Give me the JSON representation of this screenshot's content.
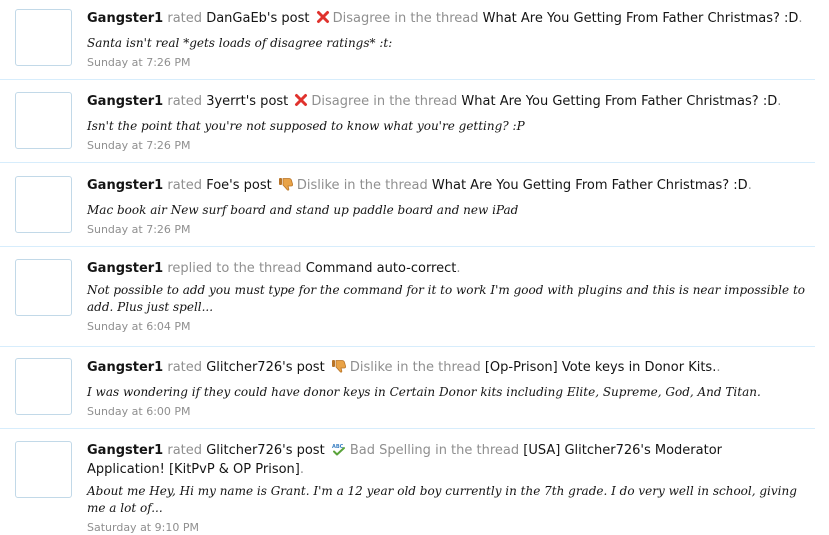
{
  "items": [
    {
      "user": "Gangster1",
      "verb": "rated",
      "target": "DanGaEb's post",
      "reaction": "Disagree",
      "reaction_icon": "red-x-icon",
      "context": "in the thread",
      "thread": "What Are You Getting From Father Christmas? :D",
      "snippet": "Santa isn't real *gets loads of disagree ratings* :t:",
      "time": "Sunday at 7:26 PM"
    },
    {
      "user": "Gangster1",
      "verb": "rated",
      "target": "3yerrt's post",
      "reaction": "Disagree",
      "reaction_icon": "red-x-icon",
      "context": "in the thread",
      "thread": "What Are You Getting From Father Christmas? :D",
      "snippet": "Isn't the point that you're not supposed to know what you're getting? :P",
      "time": "Sunday at 7:26 PM"
    },
    {
      "user": "Gangster1",
      "verb": "rated",
      "target": "Foe's post",
      "reaction": "Dislike",
      "reaction_icon": "thumbs-down-icon",
      "context": "in the thread",
      "thread": "What Are You Getting From Father Christmas? :D",
      "snippet": "Mac book air New surf board and stand up paddle board and new iPad",
      "time": "Sunday at 7:26 PM"
    },
    {
      "user": "Gangster1",
      "verb": "replied to the thread",
      "target": "",
      "reaction": "",
      "reaction_icon": "",
      "context": "",
      "thread": "Command auto-correct",
      "snippet": "Not possible to add you must type for the command for it to work I'm good with plugins and this is near impossible to add. Plus just spell...",
      "time": "Sunday at 6:04 PM"
    },
    {
      "user": "Gangster1",
      "verb": "rated",
      "target": "Glitcher726's post",
      "reaction": "Dislike",
      "reaction_icon": "thumbs-down-icon",
      "context": "in the thread",
      "thread": "[Op-Prison] Vote keys in Donor Kits.",
      "snippet": "I was wondering if they could have donor keys in Certain Donor kits including Elite, Supreme, God, And Titan.",
      "time": "Sunday at 6:00 PM"
    },
    {
      "user": "Gangster1",
      "verb": "rated",
      "target": "Glitcher726's post",
      "reaction": "Bad Spelling",
      "reaction_icon": "abc-check-icon",
      "context": "in the thread",
      "thread": "[USA] Glitcher726's Moderator Application! [KitPvP & OP Prison]",
      "snippet": "About me Hey, Hi my name is Grant. I'm a 12 year old boy currently in the 7th grade. I do very well in school, giving me a lot of...",
      "time": "Saturday at 9:10 PM"
    }
  ]
}
